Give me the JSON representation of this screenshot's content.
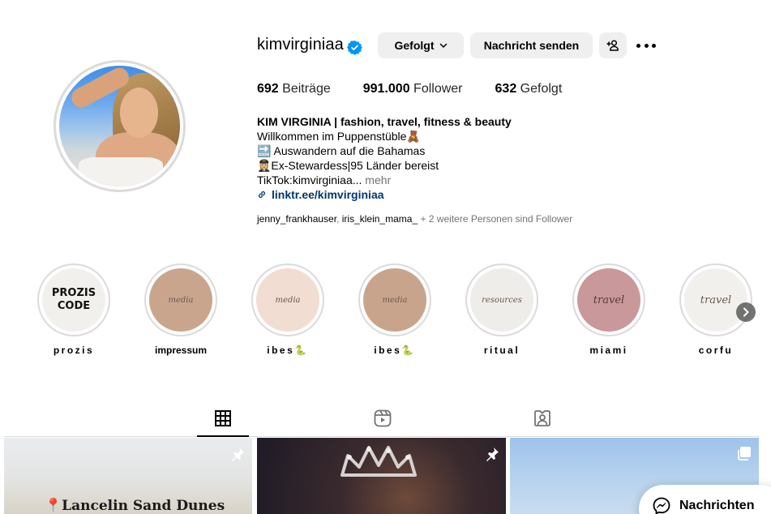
{
  "profile": {
    "username": "kimvirginiaa",
    "verified": true,
    "follow_button": "Gefolgt",
    "message_button": "Nachricht senden",
    "stats": {
      "posts_count": "692",
      "posts_label": "Beiträge",
      "followers_count": "991.000",
      "followers_label": "Follower",
      "following_count": "632",
      "following_label": "Gefolgt"
    },
    "bio": {
      "name": "KIM VIRGINIA | fashion, travel, fitness & beauty",
      "line1": "Willkommen im Puppenstüble🧸",
      "line2": "🔜 Auswandern auf die Bahamas",
      "line3": "👩🏼‍✈️Ex-Stewardess|95 Länder bereist",
      "line4": "TikTok:kimvirginiaa...",
      "more": "mehr",
      "link": "linktr.ee/kimvirginiaa"
    },
    "followed_by": {
      "user1": "jenny_frankhauser",
      "separator": ", ",
      "user2": "iris_klein_mama_",
      "rest": " + 2 weitere Personen sind Follower"
    }
  },
  "highlights": [
    {
      "label": "prozis",
      "cover_text": "PROZIS CODE",
      "cover_color": "#f2f0ec"
    },
    {
      "label": "impressum",
      "cover_text": "media",
      "cover_color": "#caa58e"
    },
    {
      "label": "ibes🐍",
      "cover_text": "media",
      "cover_color": "#f1ddd2"
    },
    {
      "label": "ibes🐍",
      "cover_text": "media",
      "cover_color": "#c9a48d"
    },
    {
      "label": "ritual",
      "cover_text": "resources",
      "cover_color": "#efede9"
    },
    {
      "label": "miami",
      "cover_text": "travel",
      "cover_color": "#c9989a"
    },
    {
      "label": "corfu",
      "cover_text": "travel",
      "cover_color": "#f2f0ec"
    }
  ],
  "tabs": [
    {
      "icon": "grid-icon",
      "active": true
    },
    {
      "icon": "reels-icon",
      "active": false
    },
    {
      "icon": "tagged-icon",
      "active": false
    }
  ],
  "posts": [
    {
      "caption": "📍Lancelin Sand Dunes",
      "pinned": true
    },
    {
      "caption": "",
      "pinned": true
    },
    {
      "caption": "",
      "pinned": false,
      "multi": true
    }
  ],
  "messages_button": "Nachrichten",
  "colors": {
    "verified": "#0095f6",
    "link": "#00376b",
    "secondary_text": "#737373",
    "button_bg": "#efefef"
  }
}
